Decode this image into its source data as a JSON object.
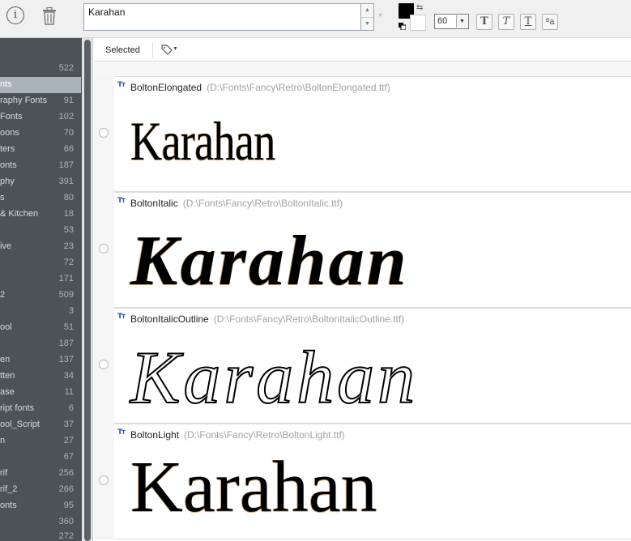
{
  "toolbar": {
    "preview_text": "Karahan",
    "font_size": "60",
    "style_buttons": [
      "T",
      "T",
      "T",
      "ªa"
    ],
    "fg_color": "#000000",
    "bg_color": "#ffffff",
    "info_glyph": "i"
  },
  "sidebar": {
    "items": [
      {
        "label": "",
        "count": "522"
      },
      {
        "label": "nts",
        "count": "",
        "active": true
      },
      {
        "label": "raphy Fonts",
        "count": "91"
      },
      {
        "label": " Fonts",
        "count": "102"
      },
      {
        "label": "oons",
        "count": "70"
      },
      {
        "label": "ters",
        "count": "66"
      },
      {
        "label": "onts",
        "count": "187"
      },
      {
        "label": "phy",
        "count": "391"
      },
      {
        "label": "s",
        "count": "80"
      },
      {
        "label": "& Kitchen",
        "count": "18"
      },
      {
        "label": "",
        "count": "53"
      },
      {
        "label": "ive",
        "count": "23"
      },
      {
        "label": "",
        "count": "72"
      },
      {
        "label": "",
        "count": "171"
      },
      {
        "label": "2",
        "count": "509"
      },
      {
        "label": "",
        "count": "3"
      },
      {
        "label": "ool",
        "count": "51"
      },
      {
        "label": "",
        "count": "187"
      },
      {
        "label": "en",
        "count": "137"
      },
      {
        "label": "tten",
        "count": "34"
      },
      {
        "label": "ase",
        "count": "11"
      },
      {
        "label": "ript fonts",
        "count": "6"
      },
      {
        "label": "ool_Script",
        "count": "37"
      },
      {
        "label": "n",
        "count": "27"
      },
      {
        "label": "",
        "count": "67"
      },
      {
        "label": "rif",
        "count": "256"
      },
      {
        "label": "rif_2",
        "count": "266"
      },
      {
        "label": "onts",
        "count": "95"
      },
      {
        "label": "",
        "count": "360"
      },
      {
        "label": "",
        "count": "272"
      }
    ]
  },
  "filter": {
    "selected_label": "Selected"
  },
  "fonts": [
    {
      "name": "BoltonElongated",
      "path": "(D:\\Fonts\\Fancy\\Retro\\BoltonElongated.ttf)",
      "sample": "Karahan"
    },
    {
      "name": "BoltonItalic",
      "path": "(D:\\Fonts\\Fancy\\Retro\\BoltonItalic.ttf)",
      "sample": "Karahan"
    },
    {
      "name": "BoltonItalicOutline",
      "path": "(D:\\Fonts\\Fancy\\Retro\\BoltonItalicOutline.ttf)",
      "sample": "Karahan"
    },
    {
      "name": "BoltonLight",
      "path": "(D:\\Fonts\\Fancy\\Retro\\BoltonLight.ttf)",
      "sample": "Karahan"
    }
  ]
}
